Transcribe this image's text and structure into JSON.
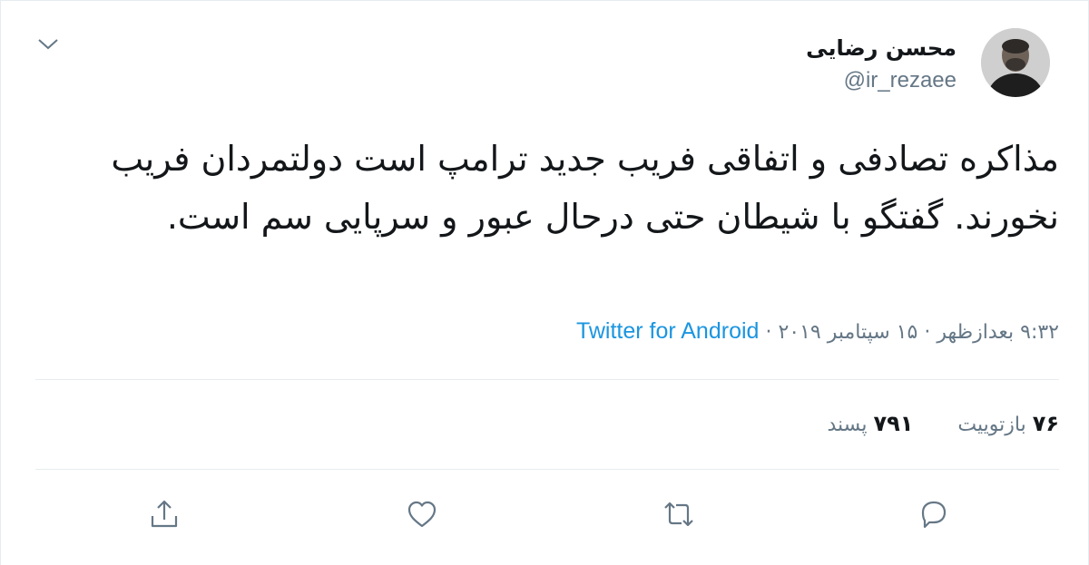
{
  "tweet": {
    "author_name": "محسن رضایی",
    "author_handle": "@ir_rezaee",
    "text": "مذاکره تصادفی و اتفاقی فریب جدید ترامپ است دولتمردان فریب نخورند. گفتگو با شیطان حتی درحال عبور و سرپایی سم است.",
    "time": "۹:۳۲ بعدازظهر",
    "date": "۱۵ سپتامبر ۲۰۱۹",
    "separator": "·",
    "source": "Twitter for Android",
    "retweets": {
      "count": "۷۶",
      "label": "بازتوییت"
    },
    "likes": {
      "count": "۷۹۱",
      "label": "پسند"
    }
  },
  "icons": {
    "caret": "chevron-down-icon",
    "reply": "reply-icon",
    "retweet": "retweet-icon",
    "like": "heart-icon",
    "share": "share-icon"
  },
  "colors": {
    "link": "#1b95e0",
    "secondary_text": "#657786",
    "divider": "#e6ecf0",
    "icon": "#657786"
  }
}
